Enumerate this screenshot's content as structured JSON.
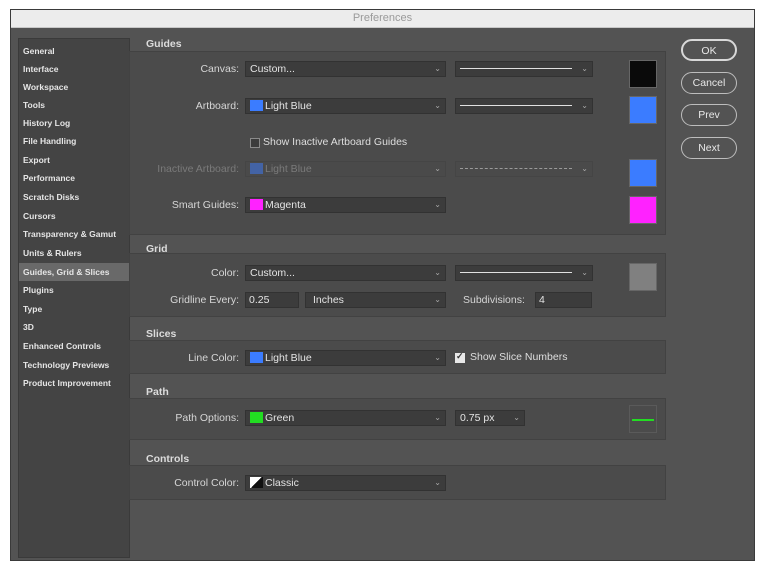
{
  "window": {
    "title": "Preferences"
  },
  "sidebar": {
    "items": [
      {
        "label": "General"
      },
      {
        "label": "Interface"
      },
      {
        "label": "Workspace"
      },
      {
        "label": "Tools"
      },
      {
        "label": "History Log"
      },
      {
        "label": "File Handling"
      },
      {
        "label": "Export"
      },
      {
        "label": "Performance"
      },
      {
        "label": "Scratch Disks"
      },
      {
        "label": "Cursors"
      },
      {
        "label": "Transparency & Gamut"
      },
      {
        "label": "Units & Rulers"
      },
      {
        "label": "Guides, Grid & Slices"
      },
      {
        "label": "Plugins"
      },
      {
        "label": "Type"
      },
      {
        "label": "3D"
      },
      {
        "label": "Enhanced Controls"
      },
      {
        "label": "Technology Previews"
      },
      {
        "label": "Product Improvement"
      }
    ],
    "selected": "Guides, Grid & Slices"
  },
  "guides": {
    "title": "Guides",
    "canvas": {
      "label": "Canvas:",
      "value": "Custom...",
      "line_style": "solid",
      "swatch": "#0a0a0a"
    },
    "artboard": {
      "label": "Artboard:",
      "value": "Light Blue",
      "color": "#3b7cff",
      "line_style": "solid",
      "swatch": "#3b7cff"
    },
    "show_inactive": {
      "label": "Show Inactive Artboard Guides",
      "checked": false
    },
    "inactive_artboard": {
      "label": "Inactive Artboard:",
      "value": "Light Blue",
      "color": "#3b7cff",
      "line_style": "dashed",
      "swatch": "#3b7cff"
    },
    "smart_guides": {
      "label": "Smart Guides:",
      "value": "Magenta",
      "color": "#ff22ff",
      "swatch": "#ff22ff"
    }
  },
  "grid": {
    "title": "Grid",
    "color": {
      "label": "Color:",
      "value": "Custom...",
      "line_style": "solid",
      "swatch": "#808080"
    },
    "gridline_every": {
      "label": "Gridline Every:",
      "value": "0.25",
      "unit": "Inches"
    },
    "subdivisions": {
      "label": "Subdivisions:",
      "value": "4"
    }
  },
  "slices": {
    "title": "Slices",
    "line_color": {
      "label": "Line Color:",
      "value": "Light Blue",
      "color": "#3b7cff"
    },
    "show_numbers": {
      "label": "Show Slice Numbers",
      "checked": true
    }
  },
  "path": {
    "title": "Path",
    "options": {
      "label": "Path Options:",
      "value": "Green",
      "color": "#22dd22"
    },
    "width": "0.75 px",
    "preview_color": "#22dd22"
  },
  "controls": {
    "title": "Controls",
    "control_color": {
      "label": "Control Color:",
      "value": "Classic"
    }
  },
  "buttons": {
    "ok": "OK",
    "cancel": "Cancel",
    "prev": "Prev",
    "next": "Next"
  }
}
